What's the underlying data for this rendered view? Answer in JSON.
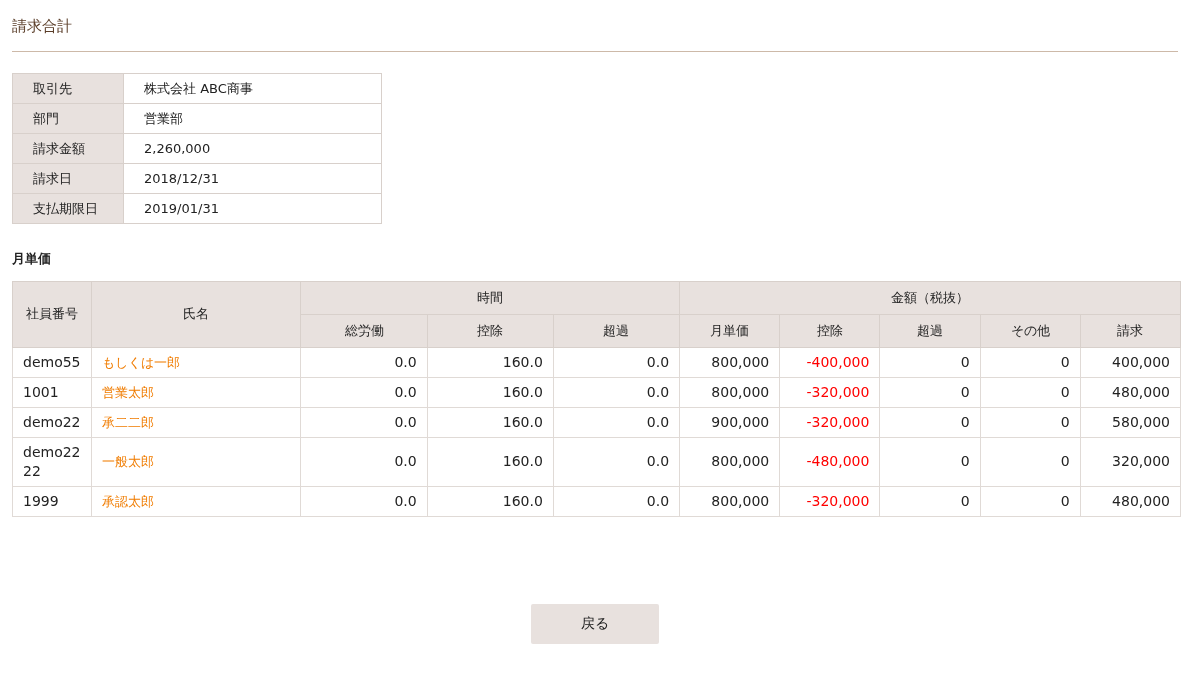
{
  "page_title": "請求合計",
  "summary": [
    {
      "label": "取引先",
      "value": "株式会社 ABC商事"
    },
    {
      "label": "部門",
      "value": "営業部"
    },
    {
      "label": "請求金額",
      "value": "2,260,000"
    },
    {
      "label": "請求日",
      "value": "2018/12/31"
    },
    {
      "label": "支払期限日",
      "value": "2019/01/31"
    }
  ],
  "section_title": "月単価",
  "table": {
    "employee_id_header": "社員番号",
    "name_header": "氏名",
    "groups": [
      {
        "label": "時間",
        "columns": [
          {
            "label": "総労働",
            "negative": false
          },
          {
            "label": "控除",
            "negative": false
          },
          {
            "label": "超過",
            "negative": false
          }
        ]
      },
      {
        "label": "金額（税抜）",
        "columns": [
          {
            "label": "月単価",
            "negative": false
          },
          {
            "label": "控除",
            "negative": true
          },
          {
            "label": "超過",
            "negative": false
          },
          {
            "label": "その他",
            "negative": false
          },
          {
            "label": "請求",
            "negative": false
          }
        ]
      }
    ],
    "rows": [
      {
        "employee_id": "demo55",
        "name": "もしくは一郎",
        "values": [
          "0.0",
          "160.0",
          "0.0",
          "800,000",
          "-400,000",
          "0",
          "0",
          "400,000"
        ]
      },
      {
        "employee_id": "1001",
        "name": "営業太郎",
        "values": [
          "0.0",
          "160.0",
          "0.0",
          "800,000",
          "-320,000",
          "0",
          "0",
          "480,000"
        ]
      },
      {
        "employee_id": "demo22",
        "name": "承二二郎",
        "values": [
          "0.0",
          "160.0",
          "0.0",
          "900,000",
          "-320,000",
          "0",
          "0",
          "580,000"
        ]
      },
      {
        "employee_id": "demo2222",
        "name": "一般太郎",
        "values": [
          "0.0",
          "160.0",
          "0.0",
          "800,000",
          "-480,000",
          "0",
          "0",
          "320,000"
        ]
      },
      {
        "employee_id": "1999",
        "name": "承認太郎",
        "values": [
          "0.0",
          "160.0",
          "0.0",
          "800,000",
          "-320,000",
          "0",
          "0",
          "480,000"
        ]
      }
    ]
  },
  "back_button": "戻る"
}
